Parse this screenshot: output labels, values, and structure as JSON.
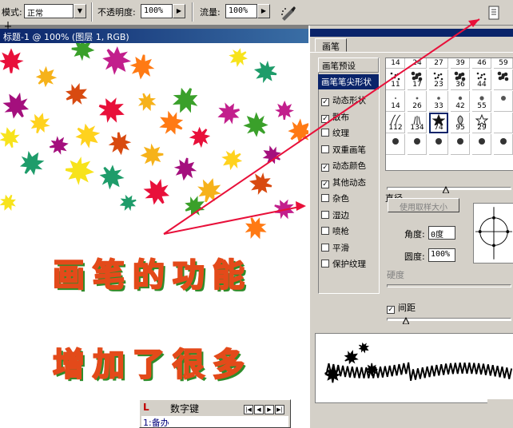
{
  "options_bar": {
    "mode_label": "模式:",
    "mode_value": "正常",
    "opacity_label": "不透明度:",
    "opacity_value": "100%",
    "flow_label": "流量:",
    "flow_value": "100%"
  },
  "document": {
    "title": "标题-1 @ 100% (图层 1, RGB)",
    "line1": "画笔的功能",
    "line2": "增加了很多"
  },
  "brushes_panel": {
    "tab_label": "画笔",
    "side_items": [
      {
        "label": "画笔预设",
        "type": "header",
        "checked": null
      },
      {
        "label": "画笔笔尖形状",
        "type": "active",
        "checked": null
      },
      {
        "label": "动态形状",
        "type": "check",
        "checked": true
      },
      {
        "label": "散布",
        "type": "check",
        "checked": true
      },
      {
        "label": "纹理",
        "type": "check",
        "checked": false
      },
      {
        "label": "双重画笔",
        "type": "check",
        "checked": false
      },
      {
        "label": "动态颜色",
        "type": "check",
        "checked": true
      },
      {
        "label": "其他动态",
        "type": "check",
        "checked": true
      },
      {
        "label": "杂色",
        "type": "check",
        "checked": false
      },
      {
        "label": "湿边",
        "type": "check",
        "checked": false
      },
      {
        "label": "喷枪",
        "type": "check",
        "checked": false
      },
      {
        "label": "平滑",
        "type": "check",
        "checked": false
      },
      {
        "label": "保护纹理",
        "type": "check",
        "checked": false
      }
    ],
    "brush_rows": [
      [
        "14",
        "24",
        "27",
        "39",
        "46",
        "59"
      ],
      [
        "11",
        "17",
        "23",
        "36",
        "44",
        ""
      ],
      [
        "14",
        "26",
        "33",
        "42",
        "55",
        ""
      ],
      [
        "112",
        "134",
        "74",
        "95",
        "29",
        ""
      ],
      [
        "",
        "",
        "",
        "",
        "",
        ""
      ]
    ],
    "diameter_label": "直径",
    "use_sample_label": "使用取样大小",
    "angle_label": "角度:",
    "angle_value": "0度",
    "roundness_label": "圆度:",
    "roundness_value": "100%",
    "hardness_label": "硬度",
    "spacing_label": "间距"
  },
  "numpad": {
    "title": "数字键",
    "item": "1:备办"
  },
  "colors": {
    "titlebar": "#0a246a",
    "arrow": "#e8103a",
    "text_fill": "#ffd21e",
    "text_stroke": "#e34a1a"
  }
}
